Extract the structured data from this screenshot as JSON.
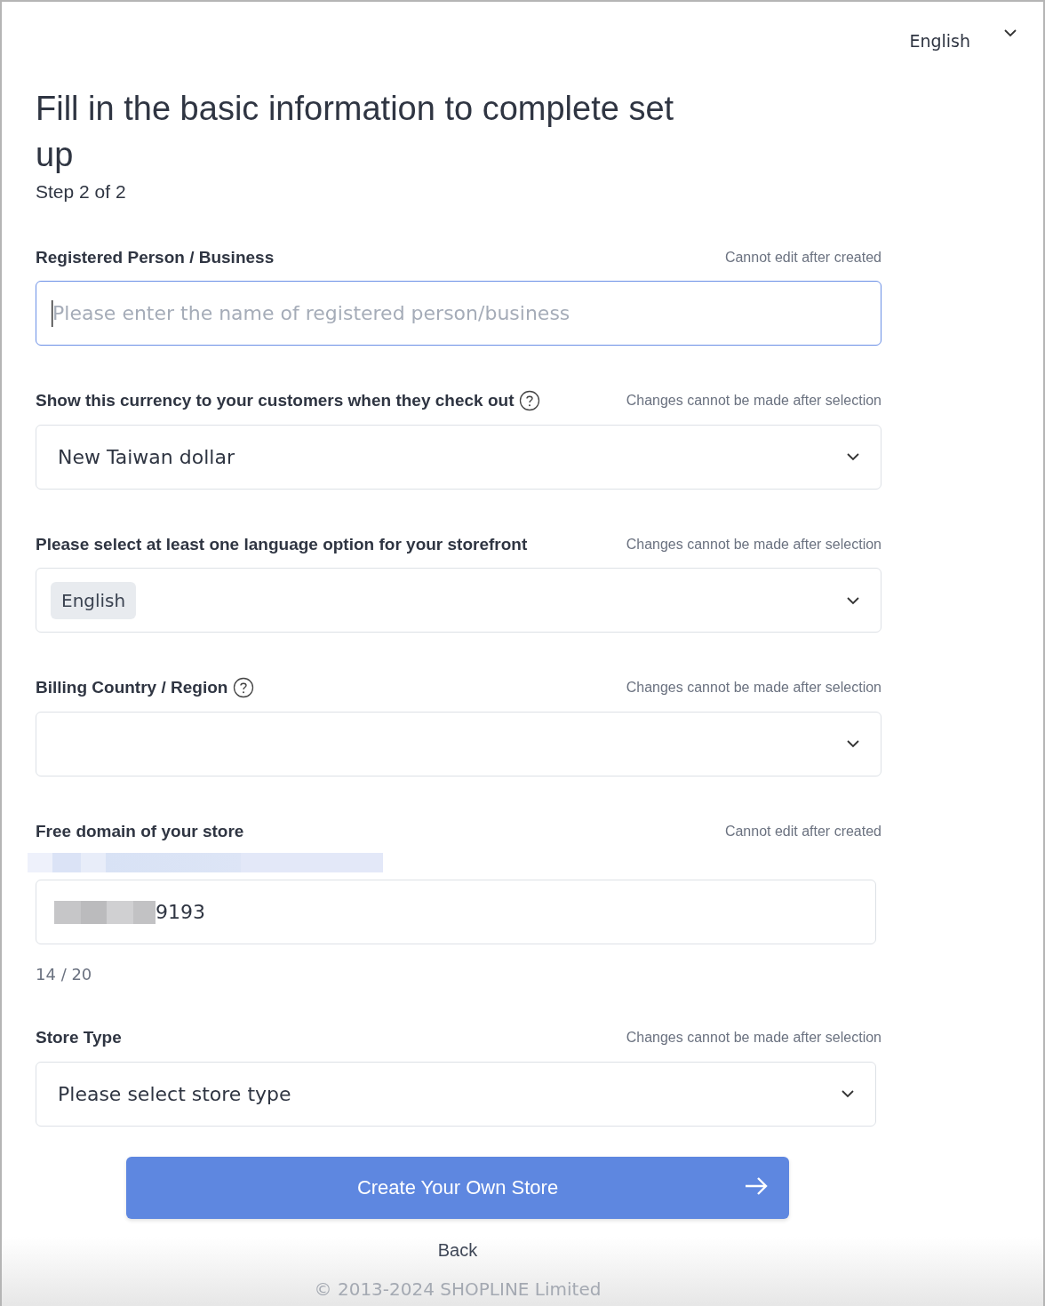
{
  "language_selector": {
    "value": "English"
  },
  "heading": {
    "title": "Fill in the basic information to complete set up",
    "step": "Step 2 of 2"
  },
  "fields": [
    {
      "kind": "text",
      "label": "Registered Person / Business",
      "help": false,
      "note": "Cannot edit after created",
      "placeholder": "Please enter the name of registered person/business",
      "focused": true
    },
    {
      "kind": "select",
      "label": "Show this currency to your customers when they check out",
      "help": true,
      "note": "Changes cannot be made after selection",
      "value": "New Taiwan dollar"
    },
    {
      "kind": "tags",
      "label": "Please select at least one language option for your storefront",
      "help": false,
      "note": "Changes cannot be made after selection",
      "tags": [
        "English"
      ]
    },
    {
      "kind": "select",
      "label": "Billing Country / Region",
      "help": true,
      "note": "Changes cannot be made after selection"
    },
    {
      "kind": "domain",
      "label": "Free domain of your store",
      "help": false,
      "note": "Cannot edit after created",
      "redacted": true,
      "value": "9193",
      "counter": "14 / 20"
    },
    {
      "kind": "select",
      "label": "Store Type",
      "help": false,
      "note": "Changes cannot be made after selection",
      "value": "Please select store type"
    }
  ],
  "submit_button": {
    "label": "Create Your Own Store"
  },
  "back_link": "Back",
  "footer": "© 2013-2024 SHOPLINE Limited"
}
